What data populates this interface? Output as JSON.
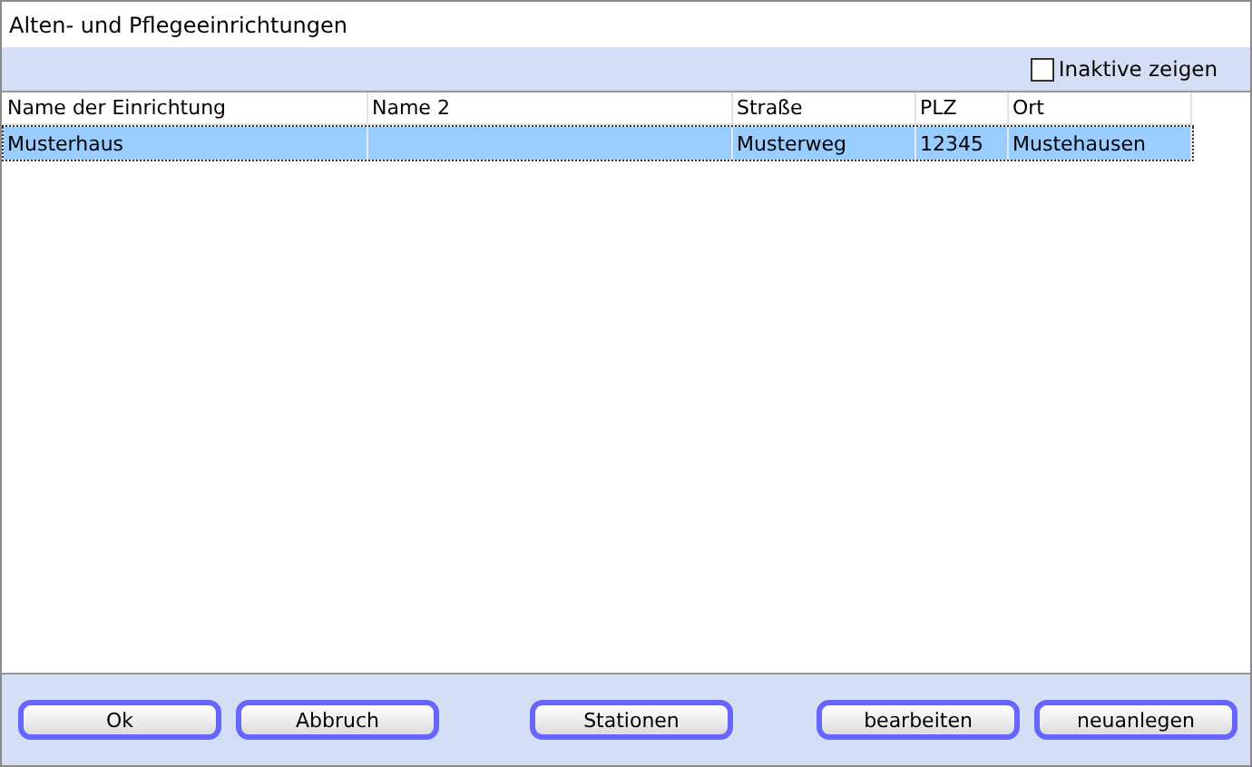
{
  "window": {
    "title": "Alten- und Pflegeeinrichtungen"
  },
  "filter": {
    "label": "Inaktive zeigen",
    "checked": false
  },
  "table": {
    "columns": [
      "Name der Einrichtung",
      "Name 2",
      "Straße",
      "PLZ",
      "Ort"
    ],
    "rows": [
      {
        "selected": true,
        "cells": [
          "Musterhaus",
          null,
          "Musterweg",
          "12345",
          "Mustehausen"
        ]
      }
    ]
  },
  "buttons": [
    "Ok",
    "Abbruch",
    "Stationen",
    "bearbeiten",
    "neuanlegen"
  ]
}
